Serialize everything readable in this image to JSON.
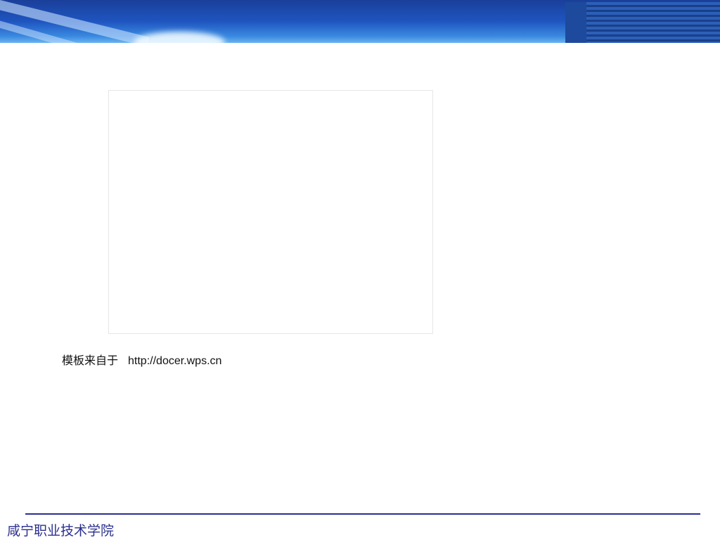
{
  "source_note": {
    "label": "模板来自于",
    "url": "http://docer.wps.cn"
  },
  "footer": {
    "institution": "咸宁职业技术学院"
  },
  "colors": {
    "accent": "#2a2f8f",
    "banner": "#1f55c0"
  }
}
